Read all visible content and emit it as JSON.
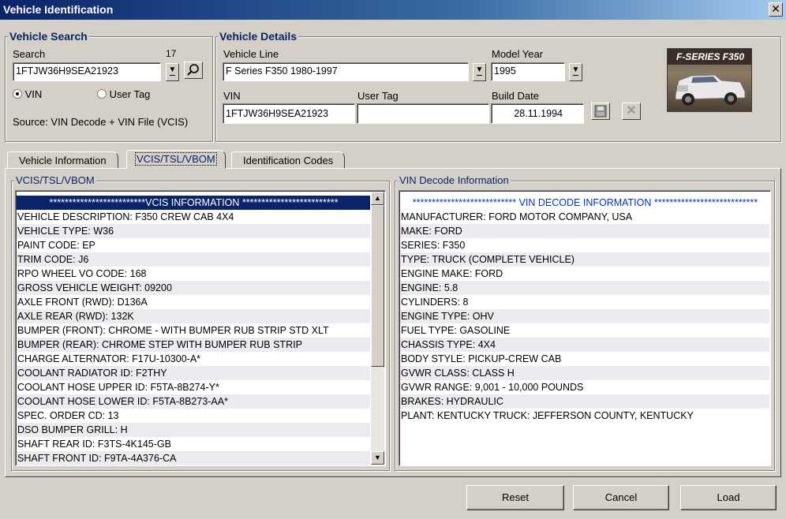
{
  "window": {
    "title": "Vehicle Identification"
  },
  "vehicle_search": {
    "title": "Vehicle Search",
    "search_label": "Search",
    "char_count": "17",
    "search_value": "1FTJW36H9SEA21923",
    "radio_vin": "VIN",
    "radio_user_tag": "User Tag",
    "selected": "VIN",
    "source_text": "Source: VIN Decode + VIN File (VCIS)"
  },
  "vehicle_details": {
    "title": "Vehicle Details",
    "vehicle_line_label": "Vehicle Line",
    "vehicle_line_value": "F Series F350 1980-1997",
    "model_year_label": "Model Year",
    "model_year_value": "1995",
    "vin_label": "VIN",
    "vin_value": "1FTJW36H9SEA21923",
    "user_tag_label": "User Tag",
    "user_tag_value": "",
    "build_date_label": "Build Date",
    "build_date_value": "28.11.1994",
    "image_caption": "F-SERIES F350"
  },
  "tabs": [
    {
      "label": "Vehicle Information"
    },
    {
      "label": "VCIS/TSL/VBOM"
    },
    {
      "label": "Identification Codes"
    }
  ],
  "vcis_panel": {
    "title": "VCIS/TSL/VBOM",
    "rows": [
      "*************************VCIS INFORMATION *************************",
      "VEHICLE DESCRIPTION:  F350 CREW CAB 4X4",
      "VEHICLE TYPE:  W36",
      "PAINT CODE:  EP",
      "TRIM CODE:  J6",
      "RPO WHEEL VO CODE:  168",
      "GROSS VEHICLE WEIGHT:  09200",
      "AXLE FRONT (RWD):  D136A",
      "AXLE REAR (RWD):  132K",
      "BUMPER (FRONT):  CHROME - WITH BUMPER RUB STRIP STD  XLT",
      "BUMPER (REAR):  CHROME STEP WITH  BUMPER RUB STRIP",
      "CHARGE ALTERNATOR:  F17U-10300-A*",
      "COOLANT RADIATOR ID:  F2THY",
      "COOLANT HOSE UPPER ID:  F5TA-8B274-Y*",
      "COOLANT HOSE LOWER ID:  F5TA-8B273-AA*",
      "SPEC. ORDER CD:  13",
      "DSO BUMPER GRILL:  H",
      "SHAFT REAR ID:  F3TS-4K145-GB",
      "SHAFT FRONT ID:  F9TA-4A376-CA"
    ]
  },
  "vin_panel": {
    "title": "VIN Decode Information",
    "rows": [
      "*************************** VIN DECODE INFORMATION ***************************",
      "MANUFACTURER: FORD MOTOR COMPANY, USA",
      "MAKE: FORD",
      "SERIES: F350",
      "TYPE: TRUCK (COMPLETE VEHICLE)",
      "ENGINE MAKE: FORD",
      "ENGINE: 5.8",
      "CYLINDERS: 8",
      "ENGINE TYPE: OHV",
      "FUEL TYPE: GASOLINE",
      "CHASSIS TYPE: 4X4",
      "BODY STYLE: PICKUP-CREW CAB",
      "GVWR CLASS: CLASS H",
      "GVWR RANGE: 9,001 - 10,000 POUNDS",
      "BRAKES: HYDRAULIC",
      "PLANT: KENTUCKY TRUCK: JEFFERSON COUNTY, KENTUCKY"
    ]
  },
  "buttons": {
    "reset": "Reset",
    "cancel": "Cancel",
    "load": "Load"
  }
}
